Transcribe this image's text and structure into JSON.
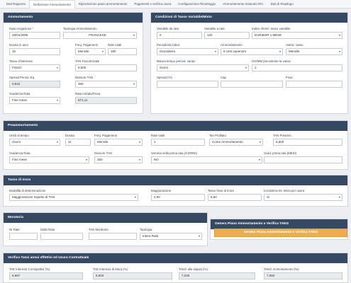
{
  "tabs": [
    "Dati Rapporto",
    "Definizione Ammortamento",
    "Riproduzione piano ammortamento",
    "Pagamenti e verifica usura",
    "Configurazione Ricarteggio",
    "Ammortamento maturato RIC",
    "Dati di Riepilogo"
  ],
  "ammortamento": {
    "title": "Ammortamento",
    "data_erogazione": {
      "label": "Data erogazione",
      "value": "29/01/2005"
    },
    "tipologia": {
      "label": "Tipologia Ammortamento",
      "value": "FRANCESE"
    },
    "durata": {
      "label": "Durata in anni",
      "value": "15"
    },
    "freq_pagamenti": {
      "label": "Freq. Pagamenti",
      "value": "Mensile"
    },
    "rate_totali": {
      "label": "Rate totali",
      "value": "180"
    },
    "tasso_interesse": {
      "label": "Tasso d'interesse",
      "value": "FISSO"
    },
    "tan": {
      "label": "TAN Fisso/Iniziale",
      "value": "6,500"
    },
    "spread": {
      "label": "Spread Period. Eq.",
      "value": "0,542"
    },
    "divisore": {
      "label": "Divisore TAN",
      "value": "360"
    },
    "scadenza": {
      "label": "Scadenza Rata",
      "value": "Fine mese"
    },
    "rata_iniziale": {
      "label": "Rata Iniziale/Fissa",
      "value": "871,11"
    }
  },
  "condizioni": {
    "title": "Condizioni di Tasso Variabile/Misto",
    "variabile_da_rata": {
      "label": "Variabile da rata",
      "value": "0"
    },
    "variabile_a_rata": {
      "label": "Variabile a rata",
      "value": "120"
    },
    "indice": {
      "label": "Indice riferim. tasso variabile",
      "value": "EURIBOR 1 MESE"
    },
    "periodicita": {
      "label": "Periodicità indice",
      "value": "Giornaliera"
    },
    "arrotondamento": {
      "label": "Arrotondamento",
      "value": "5 cent superiore"
    },
    "variaz_tasso": {
      "label": "Variaz. tasso",
      "value": "Mensile"
    },
    "misura_tempo": {
      "label": "Misura tempo preced. variaz.",
      "value": "Giorni"
    },
    "giorni_mm": {
      "label": "GG/MM precedente la variaz.",
      "value": "2"
    },
    "spread_pct": {
      "label": "Spread (%)",
      "value": ""
    },
    "cap": {
      "label": "Cap",
      "value": ""
    },
    "floor": {
      "label": "Floor",
      "value": ""
    }
  },
  "preammortamento": {
    "title": "Preammortamento",
    "unita_tempo": {
      "label": "Unità di tempo",
      "value": "Giorni"
    },
    "durata": {
      "label": "Durata",
      "value": "11"
    },
    "freq_pagamenti": {
      "label": "Freq. Pagamenti",
      "value": "Mensile"
    },
    "rate_totali": {
      "label": "Rate totali",
      "value": "1"
    },
    "tan_profilo": {
      "label": "Tan Profilato",
      "value": "Come Ammortamento"
    },
    "tan_preamm": {
      "label": "TAN Preamm.",
      "value": "6,500"
    },
    "scadenza": {
      "label": "Scadenza Rata",
      "value": "Fine mese"
    },
    "divisore": {
      "label": "Divisore TAN",
      "value": "360"
    },
    "somma_rata": {
      "label": "Somma nella prima rata (GIORNI)",
      "value": "NO"
    },
    "scad_prima_rata": {
      "label": "Scad. prima rata (MESI)",
      "value": ""
    }
  },
  "tasso_mora": {
    "title": "Tasso di mora",
    "modalita": {
      "label": "Modalità di determinazione",
      "value": "Maggiorazione rispetto al TAN"
    },
    "maggiorazione": {
      "label": "Maggiorazione",
      "value": "2,00"
    },
    "tasso_fisso": {
      "label": "Tasso fisso di mora",
      "value": "8,50"
    },
    "considera": {
      "label": "Considera Int. Mora per usura",
      "value": "Si"
    }
  },
  "moratoria": {
    "title": "Moratoria",
    "n_rate": {
      "label": "Nr Rate",
      "value": ""
    },
    "dalla_rata": {
      "label": "Dalla Rata",
      "value": ""
    },
    "tan_moratoria": {
      "label": "TAN Moratoria",
      "value": ""
    },
    "tipologia": {
      "label": "Tipologia",
      "value": "Intera Rata"
    }
  },
  "genera": {
    "title": "Genera Piano Ammortamento e Verifica TAEG",
    "button": "Genera Piano Ammortamento e Verifica TAEG"
  },
  "verifica": {
    "title": "Verifica Tassi annui effettivi ed Usura Contrattuale",
    "tae_interessi": {
      "label": "TAE Interessi Corrispettivi (%)",
      "value": "6,697"
    },
    "tae_mora": {
      "label": "TAE Interessi di Mora (%)",
      "value": "8,803"
    },
    "taeg_stipula": {
      "label": "TAEG alla stipula (%)",
      "value": "7,035"
    },
    "taeg_ammortamento": {
      "label": "TAEG Ammortamento (%)",
      "value": "7,050"
    }
  }
}
